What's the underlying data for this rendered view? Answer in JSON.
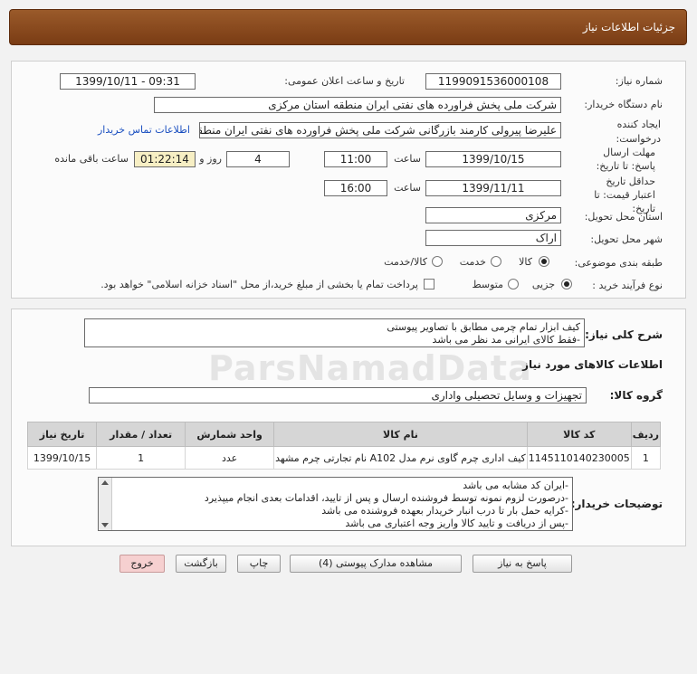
{
  "header": {
    "title": "جزئیات اطلاعات نیاز"
  },
  "details": {
    "need_no_label": "شماره نیاز:",
    "need_no": "1199091536000108",
    "announce_label": "تاریخ و ساعت اعلان عمومی:",
    "announce_value": "1399/10/11 - 09:31",
    "buyer_label": "نام دستگاه خریدار:",
    "buyer": "شرکت ملی پخش فراورده های نفتی ایران منطقه استان مرکزی",
    "creator_label": "ایجاد کننده درخواست:",
    "creator": "علیرضا پیرولی کارمند بازرگانی شرکت ملی پخش فراورده های نفتی ایران منطقه",
    "contact_link": "اطلاعات تماس خریدار",
    "deadline_label": "مهلت ارسال پاسخ: تا تاریخ:",
    "deadline_date": "1399/10/15",
    "time_label": "ساعت",
    "deadline_time": "11:00",
    "days": "4",
    "days_label": "روز و",
    "remaining_time": "01:22:14",
    "remaining_label": "ساعت باقی مانده",
    "validity_label": "حداقل تاریخ اعتبار قیمت: تا تاریخ:",
    "validity_date": "1399/11/11",
    "validity_time": "16:00",
    "province_label": "استان محل تحویل:",
    "province": "مرکزی",
    "city_label": "شهر محل تحویل:",
    "city": "اراک",
    "category_label": "طبقه بندی موضوعی:",
    "cat_options": [
      "کالا",
      "خدمت",
      "کالا/خدمت"
    ],
    "process_label": "نوع فرآیند خرید :",
    "process_options": [
      "جزیی",
      "متوسط"
    ],
    "payment_note": "پرداخت تمام یا بخشی از مبلغ خرید،از محل \"اسناد خزانه اسلامی\" خواهد بود."
  },
  "description": {
    "label": "شرح کلی نیاز:",
    "line1": "کیف ابزار تمام چرمی مطابق با تصاویر پیوستی",
    "line2": "-فقط کالای ایرانی مد نظر می باشد"
  },
  "goods": {
    "section_title": "اطلاعات کالاهای مورد نیاز",
    "group_label": "گروه کالا:",
    "group": "تجهیزات و وسایل تحصیلی واداری",
    "columns": [
      "ردیف",
      "کد کالا",
      "نام کالا",
      "واحد شمارش",
      "تعداد / مقدار",
      "تاریخ نیاز"
    ],
    "rows": [
      [
        "1",
        "1145110140230005",
        "کیف اداری چرم گاوی نرم مدل A102 نام تجارتی چرم مشهد",
        "عدد",
        "1",
        "1399/10/15"
      ]
    ]
  },
  "buyer_notes": {
    "label": "توضیحات خریدار:",
    "lines": [
      "-ایران کد مشابه می باشد",
      "-درصورت لزوم نمونه توسط فروشنده ارسال و پس از تایید، اقدامات بعدی انجام میپذیرد",
      "-کرایه حمل بار تا درب انبار خریدار بعهده فروشنده می باشد",
      "-پس از دریافت و تایید کالا واریز وجه اعتباری می باشد"
    ]
  },
  "watermark": {
    "text": "ParsNamadData"
  },
  "buttons": {
    "reply": "پاسخ به نیاز",
    "attachments": "مشاهده مدارک پیوستی (4)",
    "print": "چاپ",
    "back": "بازگشت",
    "exit": "خروج"
  }
}
